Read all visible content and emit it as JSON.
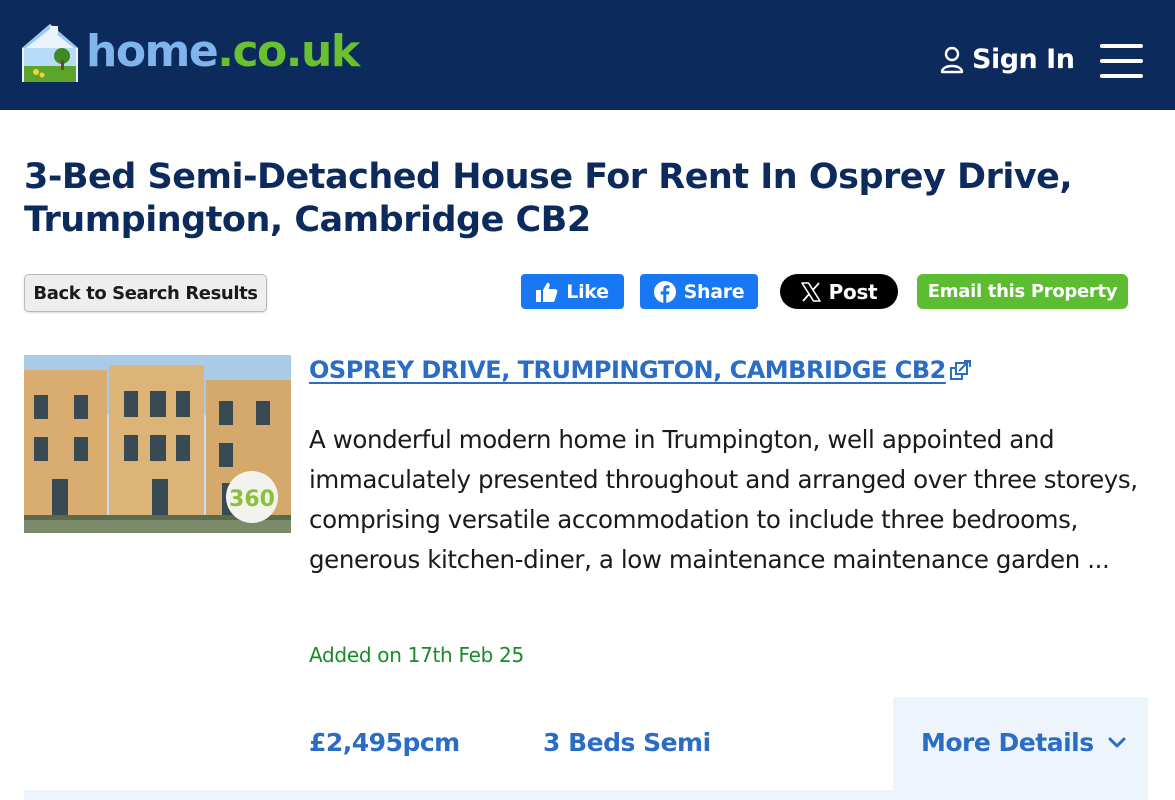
{
  "header": {
    "logo_home": "home",
    "logo_dot": ".co.uk",
    "signin_label": "Sign In",
    "icons": {
      "user": "user-icon",
      "menu": "hamburger-menu-icon",
      "logo": "house-logo-icon"
    },
    "colors": {
      "background": "#0d2a5c",
      "logo_blue": "#7fb5ec",
      "logo_green": "#6ac02e"
    }
  },
  "page": {
    "title": "3-Bed Semi-Detached House For Rent In Osprey Drive, Trumpington, Cambridge CB2"
  },
  "actions": {
    "back_label": "Back to Search Results",
    "like_label": "Like",
    "share_label": "Share",
    "post_label": "Post",
    "email_label": "Email this Property"
  },
  "listing": {
    "thumbnail_badge": "360",
    "address": "OSPREY DRIVE, TRUMPINGTON, CAMBRIDGE CB2",
    "description": "A wonderful modern home in Trumpington, well appointed and immaculately presented throughout and arranged over three storeys, comprising versatile accommodation to include three bedrooms, generous kitchen-diner, a low maintenance maintenance garden ...",
    "added": "Added on 17th Feb 25",
    "price": "£2,495pcm",
    "beds": "3 Beds Semi",
    "more_details": "More Details"
  }
}
